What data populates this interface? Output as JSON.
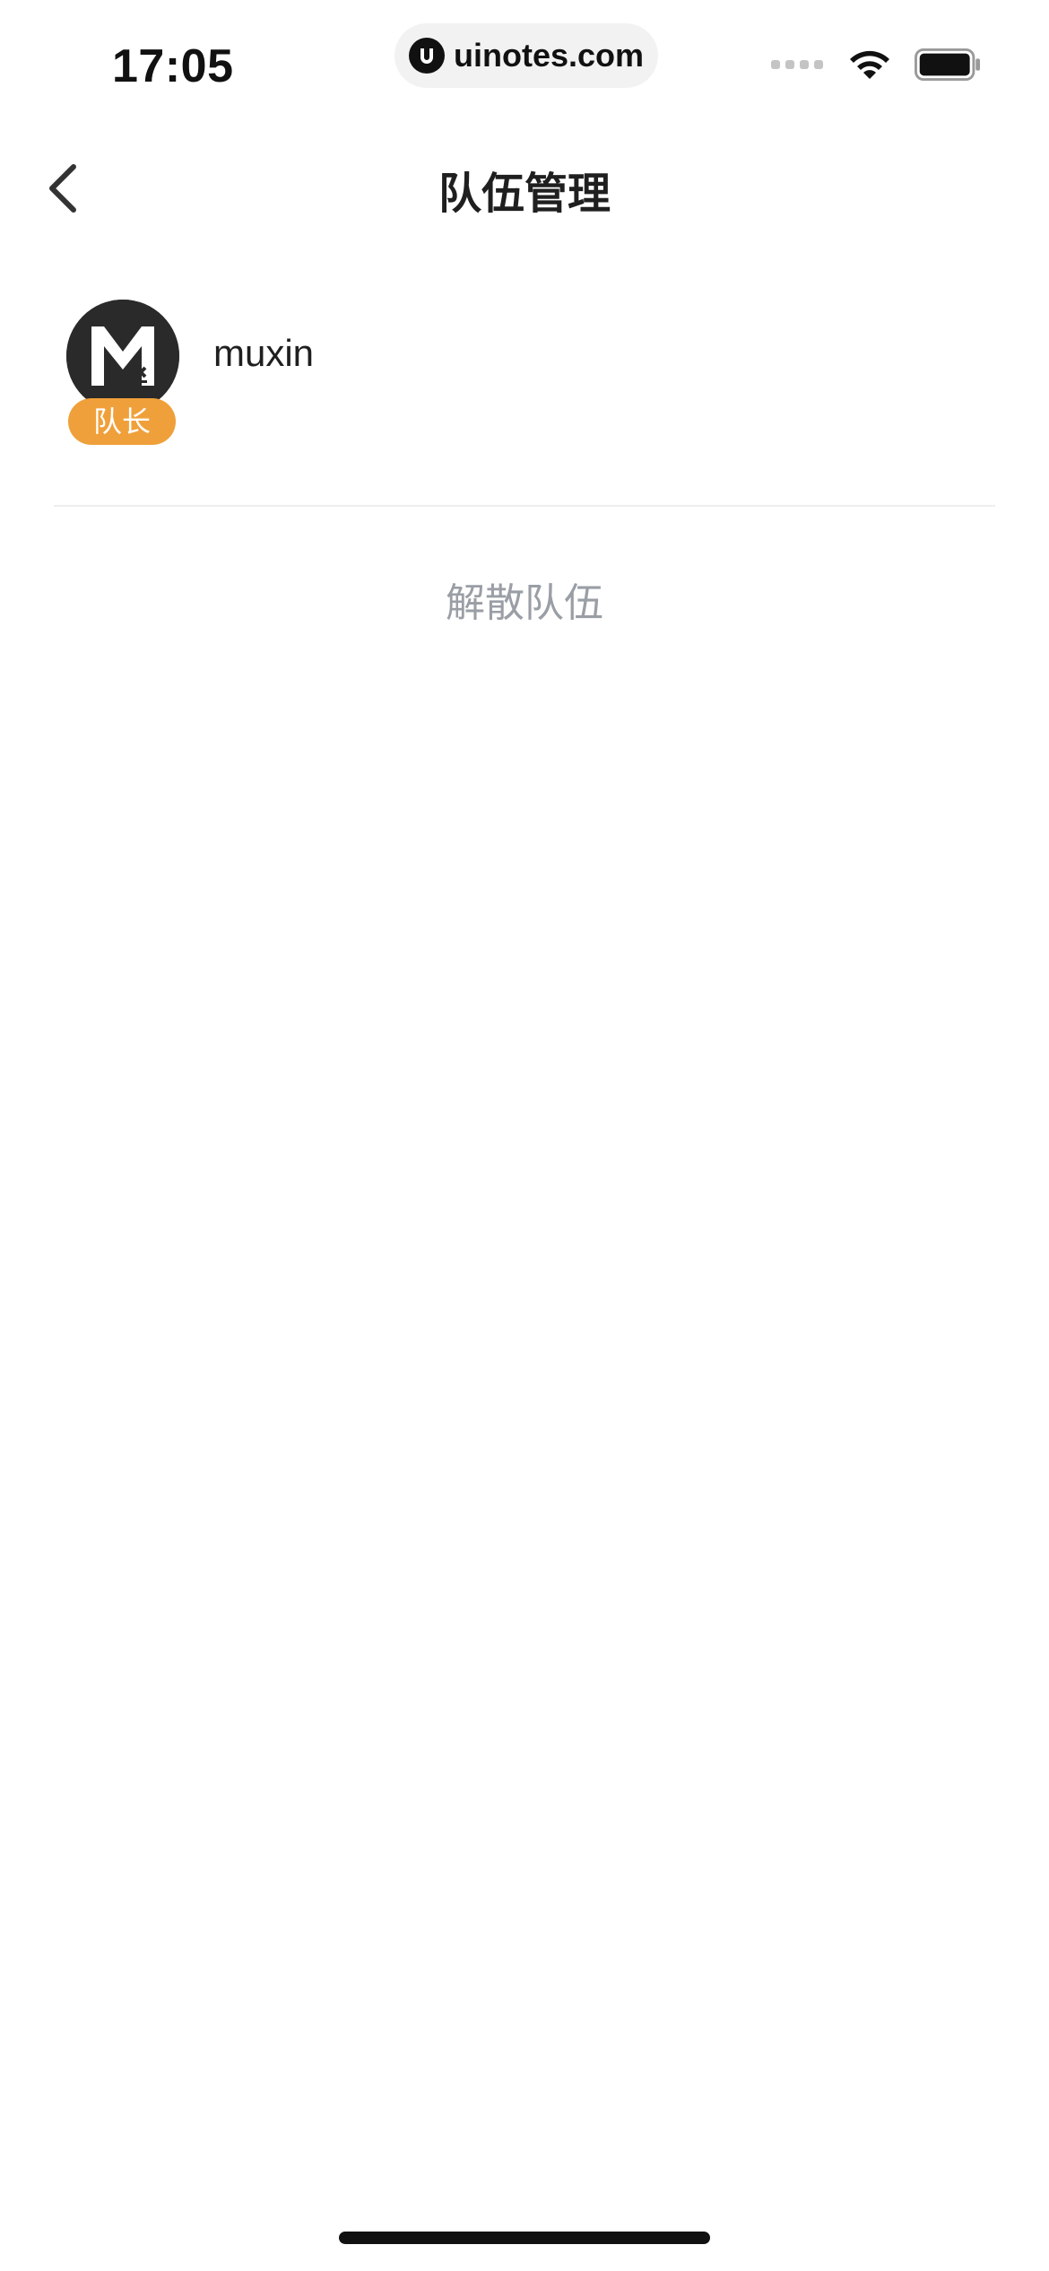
{
  "status_bar": {
    "time": "17:05",
    "url": "uinotes.com",
    "icons": [
      "cellular-signal-icon",
      "wifi-icon",
      "battery-icon"
    ]
  },
  "nav": {
    "back_icon": "chevron-left-icon",
    "title": "队伍管理"
  },
  "members": [
    {
      "name": "muxin",
      "role_badge": "队长",
      "avatar_icon": "mx-logo-avatar"
    }
  ],
  "actions": {
    "disband_label": "解散队伍"
  },
  "colors": {
    "badge": "#f0a03a",
    "disband_text": "#9a9ea5",
    "divider": "#eeeeee",
    "avatar_bg": "#2a2a2a"
  }
}
